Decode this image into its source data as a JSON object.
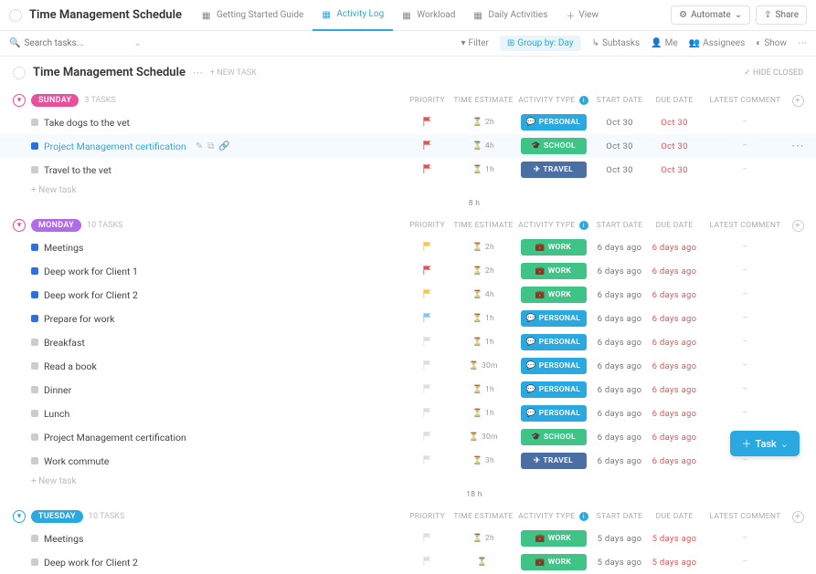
{
  "header": {
    "title": "Time Management Schedule",
    "tabs": [
      {
        "label": "Getting Started Guide",
        "active": false
      },
      {
        "label": "Activity Log",
        "active": true
      },
      {
        "label": "Workload",
        "active": false
      },
      {
        "label": "Daily Activities",
        "active": false
      }
    ],
    "view_label": "View",
    "automate_label": "Automate",
    "share_label": "Share"
  },
  "toolbar": {
    "search_placeholder": "Search tasks...",
    "filter": "Filter",
    "group_by": "Group by: Day",
    "subtasks": "Subtasks",
    "me": "Me",
    "assignees": "Assignees",
    "show": "Show"
  },
  "section": {
    "title": "Time Management Schedule",
    "new_task": "+ NEW TASK",
    "hide_closed": "HIDE CLOSED"
  },
  "columns": {
    "priority": "PRIORITY",
    "time": "TIME ESTIMATE",
    "activity": "ACTIVITY TYPE",
    "start": "START DATE",
    "due": "DUE DATE",
    "comment": "LATEST COMMENT"
  },
  "groups": [
    {
      "day": "SUNDAY",
      "day_class": "day-sunday",
      "caret": "pink",
      "count": "3 TASKS",
      "total": "8 h",
      "tasks": [
        {
          "status": "#ccc",
          "name": "Take dogs to the vet",
          "flag": "#e05555",
          "time": "2h",
          "activity": "PERSONAL",
          "act_class": "act-personal",
          "act_icon": "💬",
          "start": "Oct 30",
          "due": "Oct 30"
        },
        {
          "status": "#2d6fdb",
          "name": "Project Management certification",
          "flag": "#e05555",
          "time": "4h",
          "activity": "SCHOOL",
          "act_class": "act-school",
          "act_icon": "🎓",
          "start": "Oct 30",
          "due": "Oct 30",
          "selected": true,
          "link": true,
          "show_icons": true,
          "show_actions": true
        },
        {
          "status": "#ccc",
          "name": "Travel to the vet",
          "flag": "#e05555",
          "time": "1h",
          "activity": "TRAVEL",
          "act_class": "act-travel",
          "act_icon": "✈",
          "start": "Oct 30",
          "due": "Oct 30"
        }
      ]
    },
    {
      "day": "MONDAY",
      "day_class": "day-monday",
      "caret": "pink",
      "count": "10 TASKS",
      "total": "18 h",
      "tasks": [
        {
          "status": "#2d6fdb",
          "name": "Meetings",
          "flag": "#f2c744",
          "time": "2h",
          "activity": "WORK",
          "act_class": "act-work",
          "act_icon": "💼",
          "start": "6 days ago",
          "due": "6 days ago",
          "due_red": true
        },
        {
          "status": "#2d6fdb",
          "name": "Deep work for Client 1",
          "flag": "#e05555",
          "time": "2h",
          "activity": "WORK",
          "act_class": "act-work",
          "act_icon": "💼",
          "start": "6 days ago",
          "due": "6 days ago",
          "due_red": true
        },
        {
          "status": "#2d6fdb",
          "name": "Deep work for Client 2",
          "flag": "#f2c744",
          "time": "4h",
          "activity": "WORK",
          "act_class": "act-work",
          "act_icon": "💼",
          "start": "6 days ago",
          "due": "6 days ago",
          "due_red": true
        },
        {
          "status": "#2d6fdb",
          "name": "Prepare for work",
          "flag": "#7cc8ed",
          "time": "1h",
          "activity": "PERSONAL",
          "act_class": "act-personal",
          "act_icon": "💬",
          "start": "6 days ago",
          "due": "6 days ago",
          "due_red": true
        },
        {
          "status": "#ccc",
          "name": "Breakfast",
          "flag": "#ddd",
          "time": "1h",
          "activity": "PERSONAL",
          "act_class": "act-personal",
          "act_icon": "💬",
          "start": "6 days ago",
          "due": "6 days ago",
          "due_red": true
        },
        {
          "status": "#ccc",
          "name": "Read a book",
          "flag": "#ddd",
          "time": "30m",
          "activity": "PERSONAL",
          "act_class": "act-personal",
          "act_icon": "💬",
          "start": "6 days ago",
          "due": "6 days ago",
          "due_red": true
        },
        {
          "status": "#ccc",
          "name": "Dinner",
          "flag": "#ddd",
          "time": "1h",
          "activity": "PERSONAL",
          "act_class": "act-personal",
          "act_icon": "💬",
          "start": "6 days ago",
          "due": "6 days ago",
          "due_red": true
        },
        {
          "status": "#ccc",
          "name": "Lunch",
          "flag": "#ddd",
          "time": "1h",
          "activity": "PERSONAL",
          "act_class": "act-personal",
          "act_icon": "💬",
          "start": "6 days ago",
          "due": "6 days ago",
          "due_red": true
        },
        {
          "status": "#ccc",
          "name": "Project Management certification",
          "flag": "#ddd",
          "time": "30m",
          "activity": "SCHOOL",
          "act_class": "act-school",
          "act_icon": "🎓",
          "start": "6 days ago",
          "due": "6 days ago",
          "due_red": true
        },
        {
          "status": "#ccc",
          "name": "Work commute",
          "flag": "#ddd",
          "time": "3h",
          "activity": "TRAVEL",
          "act_class": "act-travel",
          "act_icon": "✈",
          "start": "6 days ago",
          "due": "6 days ago",
          "due_red": true
        }
      ]
    },
    {
      "day": "TUESDAY",
      "day_class": "day-tuesday",
      "caret": "blue",
      "count": "10 TASKS",
      "total": "",
      "tasks": [
        {
          "status": "#ccc",
          "name": "Meetings",
          "flag": "#ddd",
          "time": "2h",
          "activity": "WORK",
          "act_class": "act-work",
          "act_icon": "💼",
          "start": "5 days ago",
          "due": "5 days ago",
          "due_red": true
        },
        {
          "status": "#ccc",
          "name": "Deep work for Client 2",
          "flag": "#ddd",
          "time": "",
          "activity": "WORK",
          "act_class": "act-work",
          "act_icon": "💼",
          "start": "5 days ago",
          "due": "5 days ago",
          "due_red": true
        }
      ]
    }
  ],
  "new_task_label": "+ New task",
  "floating_task": "Task"
}
